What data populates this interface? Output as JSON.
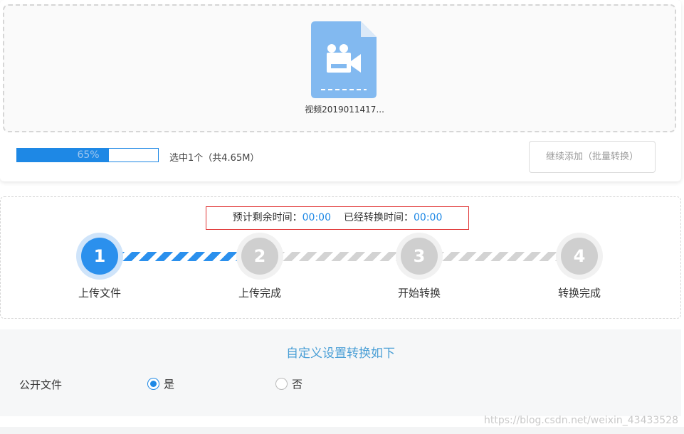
{
  "upload": {
    "file_name": "视频2019011417...",
    "file_icon": "video-file-icon",
    "progress_percent": 65,
    "progress_text": "65%",
    "selection_info": "选中1个（共4.65M）",
    "continue_label": "继续添加（批量转换）"
  },
  "timing": {
    "estimated_label": "预计剩余时间：",
    "estimated_value": "00:00",
    "elapsed_label": "已经转换时间：",
    "elapsed_value": "00:00"
  },
  "steps": [
    {
      "number": "1",
      "label": "上传文件",
      "state": "active"
    },
    {
      "number": "2",
      "label": "上传完成",
      "state": "idle"
    },
    {
      "number": "3",
      "label": "开始转换",
      "state": "idle"
    },
    {
      "number": "4",
      "label": "转换完成",
      "state": "idle"
    }
  ],
  "settings": {
    "title": "自定义设置转换如下",
    "public_file_label": "公开文件",
    "options": [
      {
        "label": "是",
        "checked": true
      },
      {
        "label": "否",
        "checked": false
      }
    ]
  },
  "colors": {
    "accent": "#2b90ed",
    "highlight_border": "#e03434",
    "idle": "#cfcfcf"
  },
  "watermark": "https://blog.csdn.net/weixin_43433528"
}
